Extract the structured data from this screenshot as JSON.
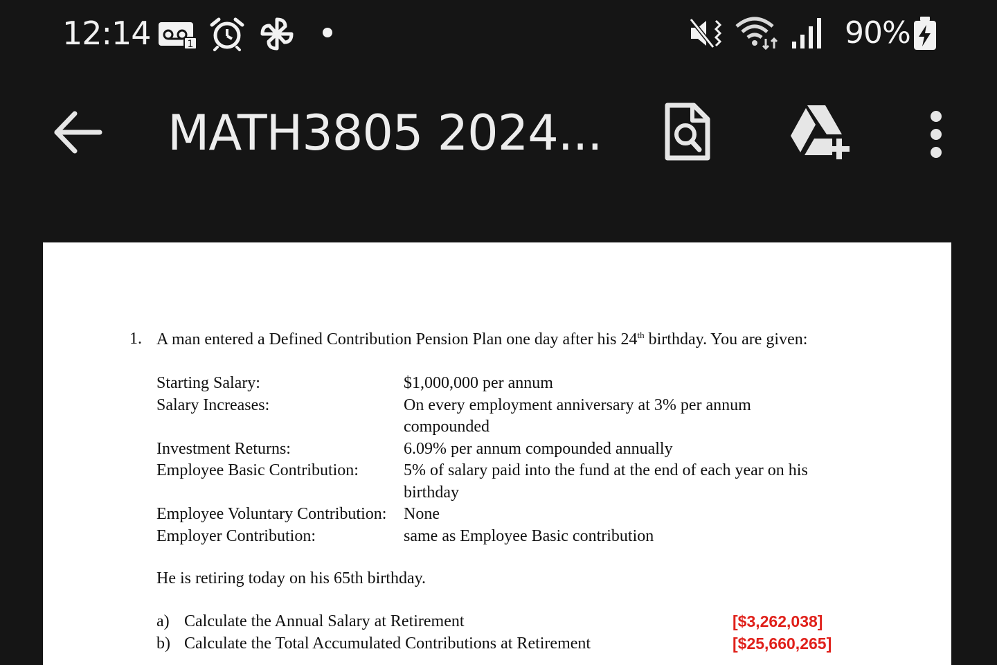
{
  "status_bar": {
    "time": "12:14",
    "battery_percent": "90%",
    "icons": [
      "voicemail-icon",
      "alarm-icon",
      "pinwheel-icon",
      "notification-dot-icon",
      "vibrate-icon",
      "wifi-icon",
      "signal-icon",
      "battery-charging-icon"
    ]
  },
  "app_bar": {
    "title": "MATH3805 2024...",
    "icons": [
      "back-arrow-icon",
      "find-in-document-icon",
      "add-to-drive-icon",
      "more-vert-icon"
    ]
  },
  "document": {
    "question_number": "1.",
    "intro_before_sup": "A man entered a Defined Contribution Pension Plan one day after his 24",
    "intro_sup": "th",
    "intro_after_sup": " birthday. You are given:",
    "givens": [
      {
        "label": "Starting Salary:",
        "value": "$1,000,000 per annum"
      },
      {
        "label": "Salary Increases:",
        "value": "On every employment anniversary at 3% per annum compounded"
      },
      {
        "label": "Investment Returns:",
        "value": "6.09% per annum compounded annually"
      },
      {
        "label": "Employee Basic Contribution:",
        "value": "5% of salary paid into the fund at the end of each year on his birthday"
      },
      {
        "label": "Employee Voluntary Contribution:",
        "value": "None"
      },
      {
        "label": "Employer Contribution:",
        "value": "same as Employee Basic contribution"
      }
    ],
    "retire_statement": "He is retiring today on his 65th birthday.",
    "parts": [
      {
        "letter": "a)",
        "text": "Calculate the Annual Salary at Retirement",
        "answer": "[$3,262,038]"
      },
      {
        "letter": "b)",
        "text": "Calculate the Total Accumulated Contributions at Retirement",
        "answer": "[$25,660,265]"
      }
    ]
  },
  "colors": {
    "background": "#151515",
    "page": "#ffffff",
    "answer_red": "#e0211b"
  }
}
